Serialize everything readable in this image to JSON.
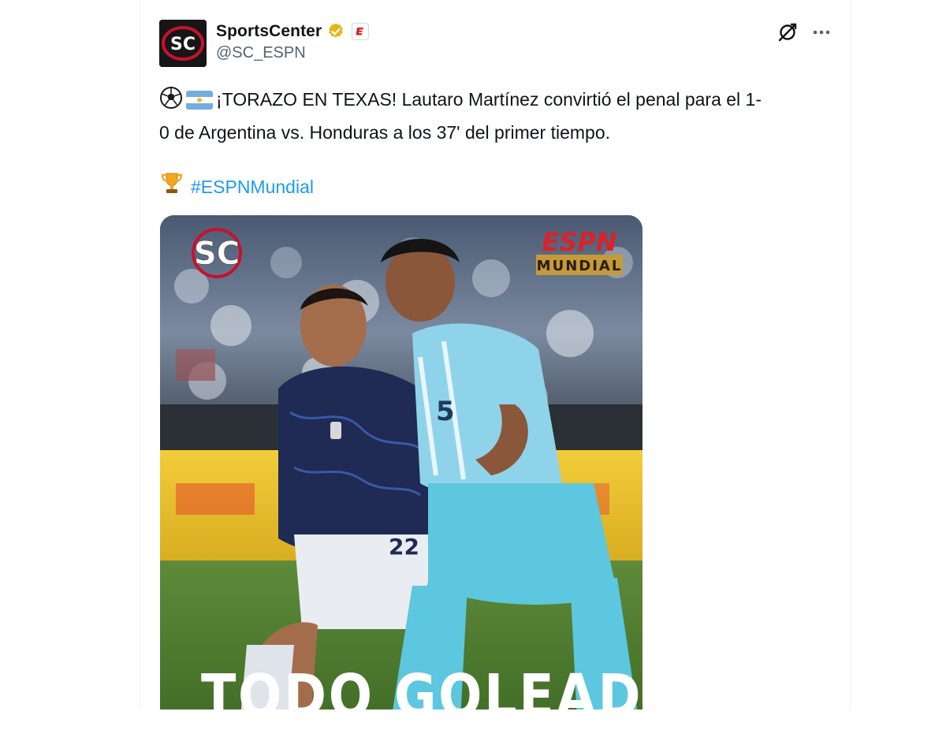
{
  "author": {
    "display_name": "SportsCenter",
    "handle": "@SC_ESPN",
    "avatar_text": "SC"
  },
  "tweet": {
    "line1": "¡TORAZO EN TEXAS! Lautaro Martínez convirtió el penal para el 1-",
    "line2": "0 de Argentina vs. Honduras a los 37' del primer tiempo.",
    "hashtag": "#ESPNMundial",
    "emojis": [
      "soccer-ball",
      "argentina-flag",
      "trophy"
    ]
  },
  "media": {
    "sc_logo": "SC",
    "espn_logo": "ESPN",
    "espn_sub": "MUNDIAL",
    "overlay_headline": "TODO GOLEADOR",
    "jersey_number_left": "22",
    "jersey_number_right": "5"
  },
  "colors": {
    "accent_link": "#1d9bf0",
    "text_primary": "#0f1419",
    "text_secondary": "#536471",
    "verified_gold": "#e2b719",
    "espn_red": "#d8232a"
  }
}
